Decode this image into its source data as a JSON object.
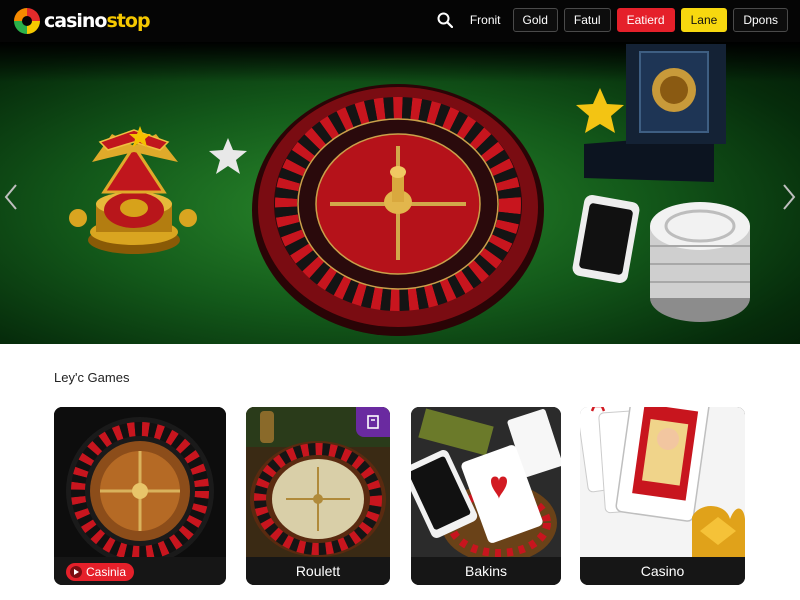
{
  "brand": {
    "part1": "casino",
    "part2": "stop"
  },
  "header": {
    "search_icon": "search-icon",
    "links": [
      "Fronit"
    ],
    "buttons": [
      {
        "label": "Gold",
        "style": "outline"
      },
      {
        "label": "Fatul",
        "style": "outline"
      },
      {
        "label": "Eatierd",
        "style": "red"
      },
      {
        "label": "Lane",
        "style": "yellow"
      },
      {
        "label": "Dpons",
        "style": "outline"
      }
    ]
  },
  "hero": {
    "prev_icon": "chevron-left-icon",
    "next_icon": "chevron-right-icon"
  },
  "section": {
    "title": "Ley'c Games",
    "cards": [
      {
        "caption": "Casinia",
        "has_pill": true
      },
      {
        "caption": "Roulett"
      },
      {
        "caption": "Bakins"
      },
      {
        "caption": "Casino"
      }
    ]
  },
  "colors": {
    "header_bg": "#050505",
    "accent_red": "#e5202a",
    "accent_yellow": "#f7d80f",
    "felt_green": "#1b6e22",
    "card_caption_bg": "#161616"
  }
}
